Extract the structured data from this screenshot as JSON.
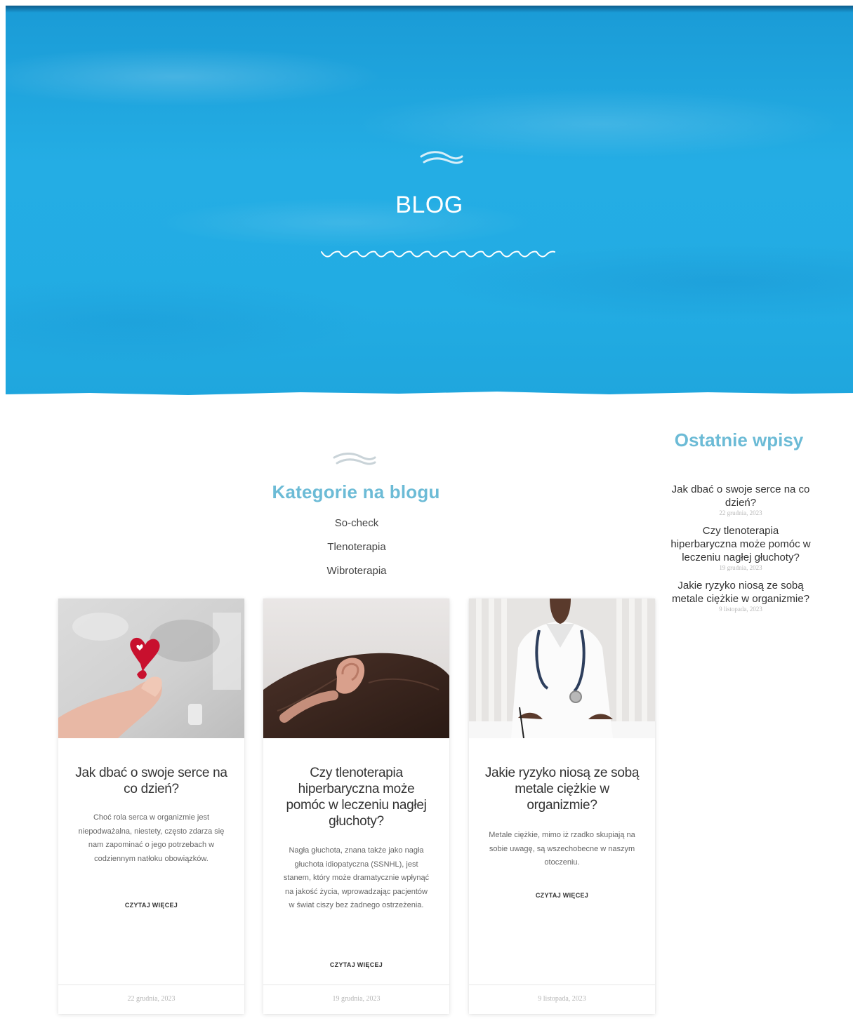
{
  "hero": {
    "title": "BLOG",
    "wave_icon": "wave-ornament-icon",
    "zigzag_icon": "zigzag-divider-icon",
    "color": "#22ace3"
  },
  "categories": {
    "heading": "Kategorie na blogu",
    "items": [
      "So-check",
      "Tlenoterapia",
      "Wibroterapia"
    ]
  },
  "sidebar": {
    "heading": "Ostatnie wpisy",
    "posts": [
      {
        "title": "Jak dbać o swoje serce na co dzień?",
        "date": "22 grudnia, 2023"
      },
      {
        "title": "Czy tlenoterapia hiperbaryczna może pomóc w leczeniu nagłej głuchoty?",
        "date": "19 grudnia, 2023"
      },
      {
        "title": "Jakie ryzyko niosą ze sobą metale ciężkie w organizmie?",
        "date": "9 listopada, 2023"
      }
    ]
  },
  "posts": [
    {
      "title": "Jak dbać o swoje serce na co dzień?",
      "excerpt": "Choć rola serca w organizmie jest niepodważalna, niestety, często zdarza się nam zapominać o jego potrzebach w codziennym natłoku obowiązków.",
      "more": "CZYTAJ WIĘCEJ",
      "date": "22 grudnia, 2023",
      "image": "heart-in-hand-photo"
    },
    {
      "title": "Czy tlenoterapia hiperbaryczna może pomóc w leczeniu nagłej głuchoty?",
      "excerpt": "Nagła głuchota, znana także jako nagła głuchota idiopatyczna (SSNHL), jest stanem, który może dramatycznie wpłynąć na jakość życia, wprowadzając pacjentów w świat ciszy bez żadnego ostrzeżenia.",
      "more": "CZYTAJ WIĘCEJ",
      "date": "19 grudnia, 2023",
      "image": "ear-close-up-photo"
    },
    {
      "title": "Jakie ryzyko niosą ze sobą metale ciężkie w organizmie?",
      "excerpt": "Metale ciężkie, mimo iż rzadko skupiają na sobie uwagę, są wszechobecne w naszym otoczeniu.",
      "more": "CZYTAJ WIĘCEJ",
      "date": "9 listopada, 2023",
      "image": "doctor-with-stethoscope-photo"
    }
  ],
  "colors": {
    "accent_heading": "#6cbbd6",
    "hero_blue": "#22ace3"
  }
}
